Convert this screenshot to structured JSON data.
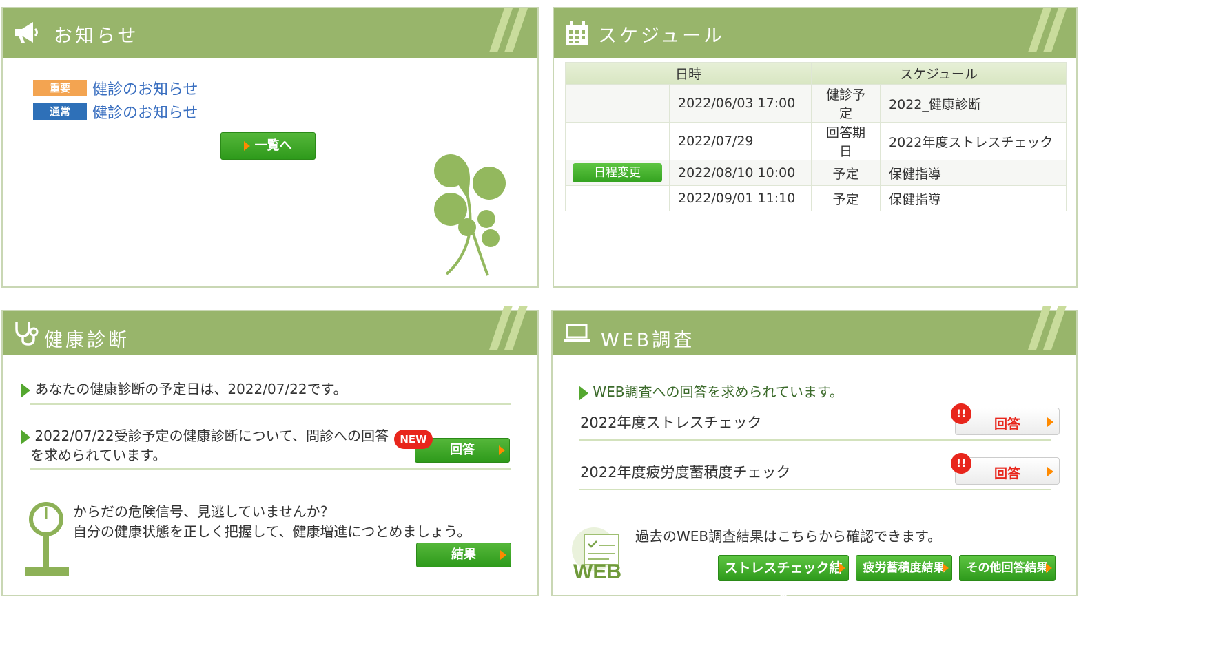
{
  "notice": {
    "title": "お知らせ",
    "items": [
      {
        "badge": "重要",
        "text": "健診のお知らせ"
      },
      {
        "badge": "通常",
        "text": "健診のお知らせ"
      }
    ],
    "list_button": "一覧へ"
  },
  "schedule": {
    "title": "スケジュール",
    "headers": [
      "日時",
      "スケジュール"
    ],
    "rows": [
      {
        "action": "",
        "datetime": "2022/06/03 17:00",
        "type": "健診予定",
        "content": "2022_健康診断"
      },
      {
        "action": "",
        "datetime": "2022/07/29",
        "type": "回答期日",
        "content": "2022年度ストレスチェック"
      },
      {
        "action": "日程変更",
        "datetime": "2022/08/10 10:00",
        "type": "予定",
        "content": "保健指導"
      },
      {
        "action": "",
        "datetime": "2022/09/01 11:10",
        "type": "予定",
        "content": "保健指導"
      }
    ]
  },
  "health": {
    "title": "健康診断",
    "scheduled_text": "あなたの健康診断の予定日は、2022/07/22です。",
    "questionnaire_text_1": "2022/07/22受診予定の健康診断について、問診への回答",
    "questionnaire_text_2": "を求められています。",
    "new_badge": "NEW",
    "answer_button": "回答",
    "risk_text_1": "からだの危険信号、見逃していませんか？",
    "risk_text_2": "自分の健康状態を正しく把握して、健康増進につとめましょう。",
    "result_button": "結果"
  },
  "web": {
    "title": "WEB調査",
    "intro": "WEB調査への回答を求められています。",
    "surveys": [
      {
        "name": "2022年度ストレスチェック",
        "alert": "!!",
        "button": "回答"
      },
      {
        "name": "2022年度疲労度蓄積度チェック",
        "alert": "!!",
        "button": "回答"
      }
    ],
    "past_text": "過去のWEB調査結果はこちらから確認できます。",
    "web_logo": "WEB",
    "result_buttons": [
      "ストレスチェック結果",
      "疲労蓄積度結果",
      "その他回答結果"
    ]
  },
  "colors": {
    "header_green": "#98b56b",
    "button_green": "#33a21f",
    "alert_red": "#e8261c",
    "link_blue": "#3a6fc0",
    "badge_orange": "#f3a451",
    "badge_blue": "#2e70b8"
  }
}
